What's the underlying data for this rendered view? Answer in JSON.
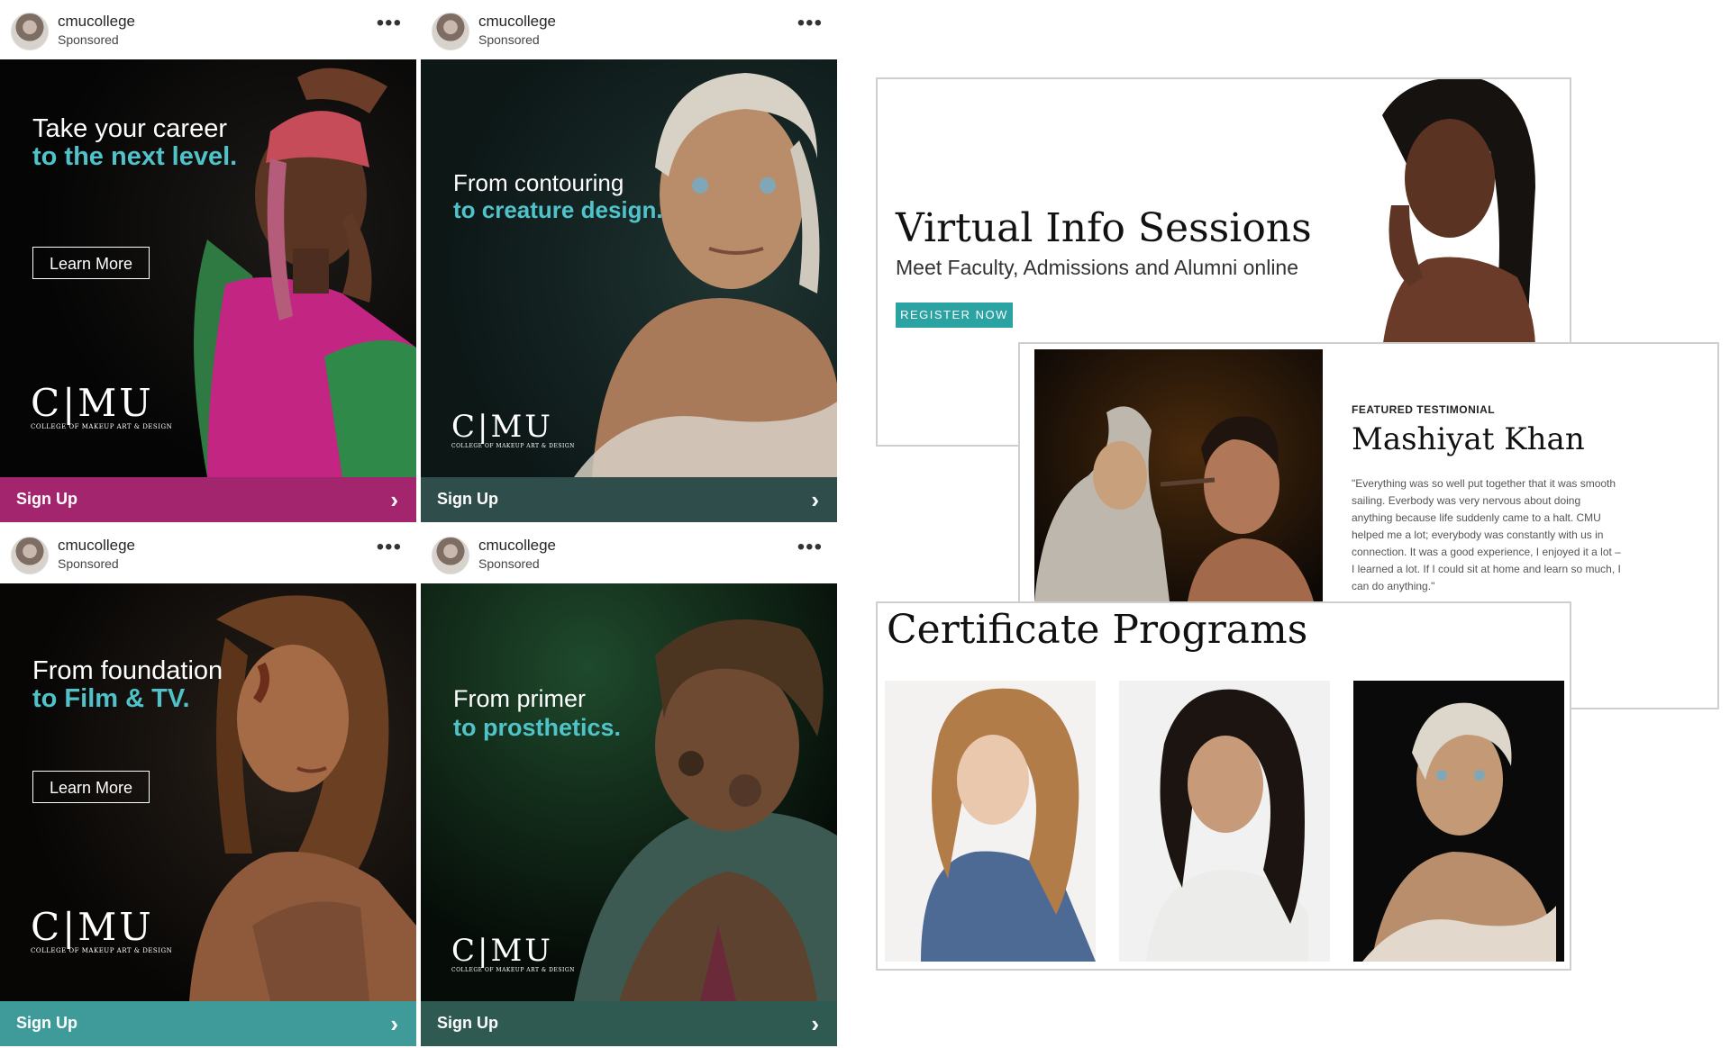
{
  "posts": [
    {
      "account": "cmucollege",
      "sponsored": "Sponsored",
      "menu": "•••",
      "headline": "Take your career",
      "accent": "to the next level.",
      "button": "Learn More",
      "logo": "C|MU",
      "logo_sub": "COLLEGE OF MAKEUP ART & DESIGN",
      "cta": "Sign Up",
      "cta_color": "#a3256e"
    },
    {
      "account": "cmucollege",
      "sponsored": "Sponsored",
      "menu": "•••",
      "headline": "From contouring",
      "accent": "to creature design.",
      "logo": "C|MU",
      "logo_sub": "COLLEGE OF MAKEUP ART & DESIGN",
      "cta": "Sign Up",
      "cta_color": "#2e4d4b"
    },
    {
      "account": "cmucollege",
      "sponsored": "Sponsored",
      "menu": "•••",
      "headline": "From foundation",
      "accent": "to Film & TV.",
      "button": "Learn More",
      "logo": "C|MU",
      "logo_sub": "COLLEGE OF MAKEUP ART & DESIGN",
      "cta": "Sign Up",
      "cta_color": "#3f9a9a"
    },
    {
      "account": "cmucollege",
      "sponsored": "Sponsored",
      "menu": "•••",
      "headline": "From primer",
      "accent": "to prosthetics.",
      "logo": "C|MU",
      "logo_sub": "COLLEGE OF MAKEUP ART & DESIGN",
      "cta": "Sign Up",
      "cta_color": "#2f5a51"
    }
  ],
  "cta_icon": "chevron-right-icon",
  "info": {
    "title": "Virtual Info Sessions",
    "subtitle": "Meet Faculty, Admissions and Alumni online",
    "button": "REGISTER NOW",
    "button_color": "#2ba3a3"
  },
  "testimonial": {
    "kicker": "FEATURED TESTIMONIAL",
    "name": "Mashiyat Khan",
    "quote": "\"Everything was so well put together that it was smooth sailing. Everbody was very nervous about doing anything because life suddenly came to a halt. CMU helped me a lot; everybody was constantly with us in connection. It was a good experience, I enjoyed it a lot – I learned a lot. If I could sit at home and learn so much, I can do anything.\""
  },
  "certificates": {
    "title": "Certificate Programs"
  },
  "colors": {
    "accent": "#4fc3c9",
    "text": "#262626"
  }
}
